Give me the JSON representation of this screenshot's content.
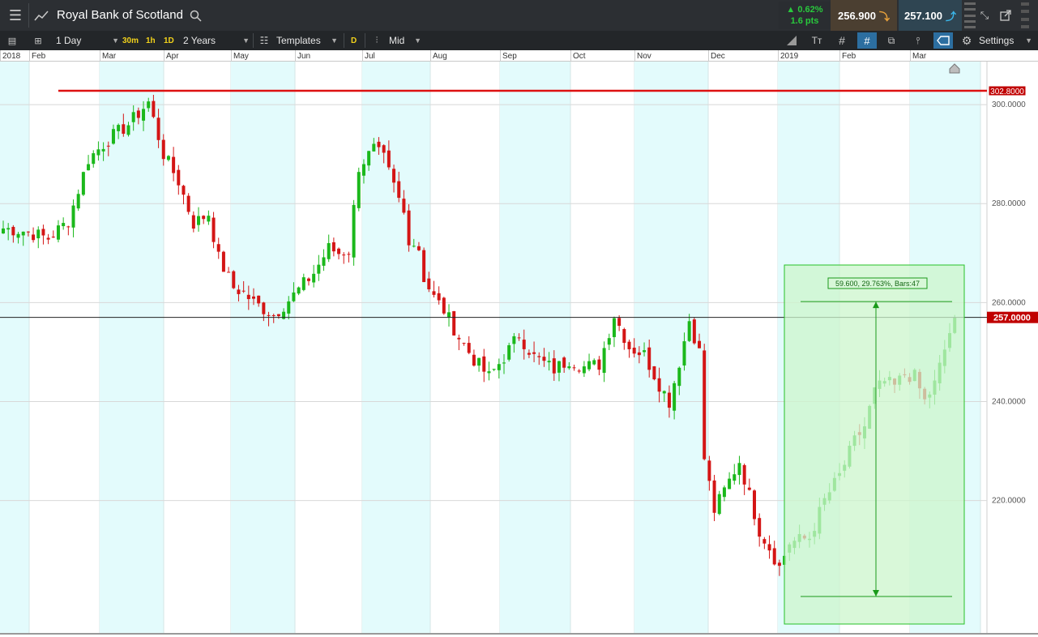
{
  "header": {
    "instrument": "Royal Bank of Scotland",
    "change_pct": "▲ 0.62%",
    "change_pts": "1.6 pts",
    "sell_price": "256.900",
    "buy_price": "257.100"
  },
  "toolbar": {
    "interval": "1 Day",
    "quick_30m": "30m",
    "quick_1h": "1h",
    "quick_1d": "1D",
    "range": "2 Years",
    "templates": "Templates",
    "d_badge": "D",
    "price_type": "Mid",
    "settings": "Settings"
  },
  "icons": [
    "menu-icon",
    "line-chart-icon",
    "search-icon",
    "minimize-icon",
    "popout-icon",
    "list-icon",
    "layout-icon",
    "sliders-icon",
    "candle-type-icon",
    "draw-line-icon",
    "text-tool-icon",
    "grid-icon",
    "crosshair-icon",
    "windows-icon",
    "indicator-icon",
    "label-tool-icon",
    "gear-icon"
  ],
  "colors": {
    "up_candle": "#1bb81b",
    "down_candle": "#d41515",
    "resistance_line": "#dd1111",
    "price_tag": "#c00000",
    "measure_fill": "#ccf5cc",
    "measure_border": "#27c227",
    "month_shade": "#e3fbfc"
  },
  "chart_data": {
    "type": "candlestick",
    "months": [
      "2018",
      "Feb",
      "Mar",
      "Apr",
      "May",
      "Jun",
      "Jul",
      "Aug",
      "Sep",
      "Oct",
      "Nov",
      "Dec",
      "2019",
      "Feb",
      "Mar"
    ],
    "y_ticks": [
      "300.0000",
      "280.0000",
      "260.0000",
      "240.0000",
      "220.0000"
    ],
    "y_tick_values": [
      300,
      280,
      260,
      240,
      220
    ],
    "ylim": [
      193.4,
      308.7
    ],
    "resistance_level": 302.8,
    "resistance_label": "302.8000",
    "current_price": 257.0,
    "current_price_label": "257.0000",
    "measure": {
      "text": "59.600, 29.763%, Bars:47",
      "from_price": 200.6,
      "to_price": 260.2,
      "change": 59.6,
      "change_pct": 29.763,
      "bars": 47
    },
    "close_path": [
      [
        0,
        275
      ],
      [
        4,
        274.5
      ],
      [
        9,
        273
      ],
      [
        13,
        276.5
      ],
      [
        17,
        289
      ],
      [
        21,
        293
      ],
      [
        25,
        296
      ],
      [
        29,
        300.5
      ],
      [
        32,
        290
      ],
      [
        35,
        284.5
      ],
      [
        38,
        276
      ],
      [
        41,
        278
      ],
      [
        43,
        269
      ],
      [
        46,
        263
      ],
      [
        48,
        262
      ],
      [
        50,
        260
      ],
      [
        54,
        257.5
      ],
      [
        58,
        261.5
      ],
      [
        62,
        266
      ],
      [
        65,
        271
      ],
      [
        67,
        270
      ],
      [
        69,
        270.5
      ],
      [
        71,
        287.5
      ],
      [
        74,
        291
      ],
      [
        76,
        289
      ],
      [
        78,
        283.5
      ],
      [
        80,
        278
      ],
      [
        81,
        273
      ],
      [
        83,
        271
      ],
      [
        84,
        265
      ],
      [
        86,
        261
      ],
      [
        88,
        258.5
      ],
      [
        91,
        253
      ],
      [
        94,
        248.5
      ],
      [
        97,
        245
      ],
      [
        100,
        249
      ],
      [
        103,
        253.5
      ],
      [
        106,
        249
      ],
      [
        110,
        246.5
      ],
      [
        113,
        248.5
      ],
      [
        116,
        247
      ],
      [
        119,
        247.5
      ],
      [
        122,
        257.5
      ],
      [
        125,
        251
      ],
      [
        128,
        249.5
      ],
      [
        131,
        243.5
      ],
      [
        133,
        240
      ],
      [
        135,
        248
      ],
      [
        137,
        256.5
      ],
      [
        139,
        250
      ],
      [
        140,
        228.5
      ],
      [
        142,
        218
      ],
      [
        145,
        224
      ],
      [
        147,
        228
      ],
      [
        149,
        221
      ],
      [
        151,
        214
      ],
      [
        153,
        210.5
      ],
      [
        155,
        206.5
      ],
      [
        157,
        211.5
      ],
      [
        161,
        212.5
      ],
      [
        164,
        220
      ],
      [
        167,
        225
      ],
      [
        170,
        232
      ],
      [
        172,
        235
      ],
      [
        174,
        242
      ],
      [
        176,
        244
      ],
      [
        178,
        243
      ],
      [
        180,
        245.5
      ],
      [
        182,
        245
      ],
      [
        184,
        240
      ],
      [
        186,
        243.5
      ],
      [
        189,
        254
      ],
      [
        190,
        257
      ]
    ]
  }
}
